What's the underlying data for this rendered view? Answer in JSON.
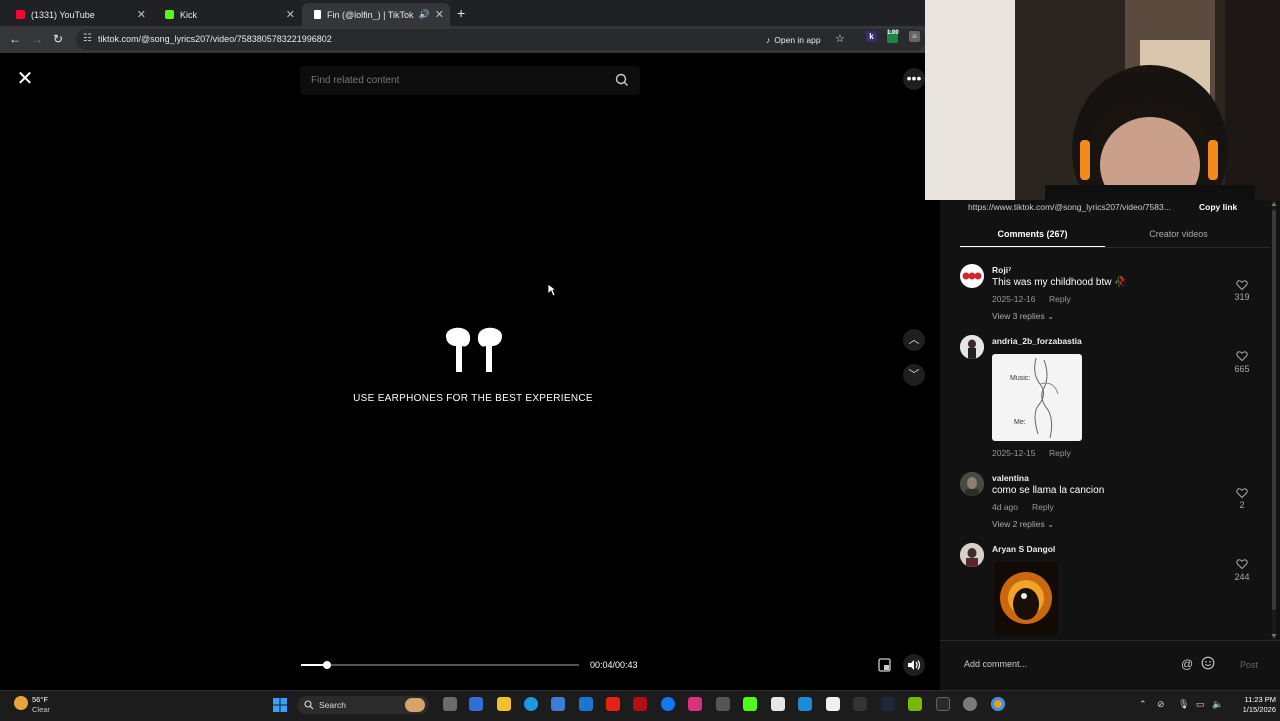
{
  "browser": {
    "tabs": [
      {
        "title": "(1331) YouTube",
        "favicon_color": "#ff0033"
      },
      {
        "title": "Kick",
        "favicon_color": "#53fc18"
      },
      {
        "title": "Fin (@lolfin_) | TikTok",
        "favicon_color": "#ffffff"
      }
    ],
    "new_tab_label": "+",
    "url": "tiktok.com/@song_lyrics207/video/7583805783221996802",
    "open_in_app": "Open in app",
    "ext_badge": "1.00"
  },
  "player": {
    "search_placeholder": "Find related content",
    "earphones_notice": "USE EARPHONES FOR THE BEST EXPERIENCE",
    "time": "00:04/00:43",
    "progress_fraction": 0.093
  },
  "share": {
    "link": "https://www.tiktok.com/@song_lyrics207/video/7583...",
    "copy_label": "Copy link"
  },
  "comments_panel": {
    "tab_comments": "Comments (267)",
    "tab_creator": "Creator videos",
    "add_placeholder": "Add comment...",
    "post_label": "Post",
    "at_symbol": "@",
    "comments": [
      {
        "user": "Roji⁷",
        "text": "This was my childhood btw 🥀",
        "date": "2025-12-16",
        "reply": "Reply",
        "view_replies": "View 3 replies",
        "likes": "319"
      },
      {
        "user": "andria_2b_forzabastia",
        "sticker_top": "Music:",
        "sticker_bottom": "Me:",
        "date": "2025-12-15",
        "reply": "Reply",
        "likes": "665"
      },
      {
        "user": "valentina",
        "text": "como se llama la cancion",
        "date": "4d ago",
        "reply": "Reply",
        "view_replies": "View 2 replies",
        "likes": "2"
      },
      {
        "user": "Aryan S Dangol",
        "likes": "244"
      }
    ]
  },
  "taskbar": {
    "weather_temp": "56°F",
    "weather_cond": "Clear",
    "search_label": "Search",
    "time": "11:23 PM",
    "date": "1/15/2026"
  }
}
